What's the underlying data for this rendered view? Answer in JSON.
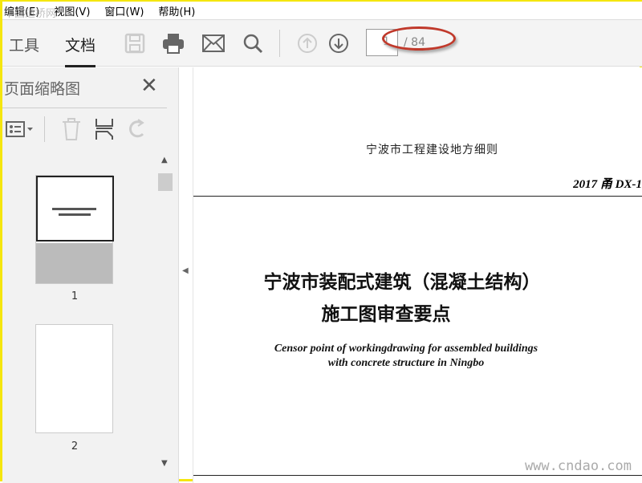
{
  "menu": [
    "编辑(E)",
    "视图(V)",
    "窗口(W)",
    "帮助(H)"
  ],
  "watermark_top": "中国道桥网",
  "tabs": [
    "工具",
    "文档"
  ],
  "page": {
    "current": "1",
    "total": "/ 84"
  },
  "sidebar": {
    "title": "页面缩略图",
    "close": "✕",
    "thumbnails": [
      {
        "label": "1"
      },
      {
        "label": "2"
      }
    ]
  },
  "document": {
    "header": "宁波市工程建设地方细则",
    "code": "2017 甬  DX-1",
    "title1": "宁波市装配式建筑（混凝土结构）",
    "title2": "施工图审查要点",
    "english": "Censor point of workingdrawing for assembled buildings with concrete structure in Ningbo"
  },
  "watermark": "www.cndao.com"
}
